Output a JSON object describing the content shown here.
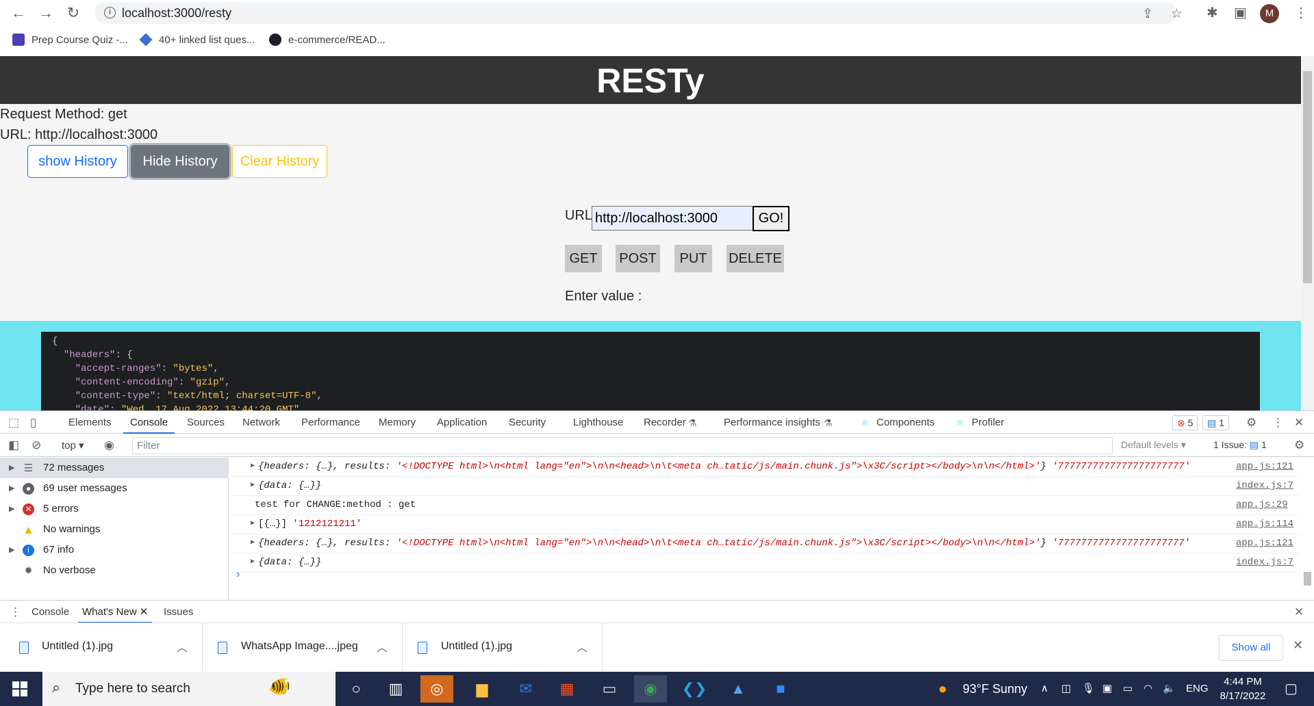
{
  "browser": {
    "url": "localhost:3000/resty",
    "avatar_letter": "M",
    "bookmarks": [
      {
        "label": "Prep Course Quiz -..."
      },
      {
        "label": "40+ linked list ques..."
      },
      {
        "label": "e-commerce/READ..."
      }
    ]
  },
  "app": {
    "title": "RESTy",
    "request_method_line": "Request Method: get",
    "url_line": "URL: http://localhost:3000",
    "history_buttons": {
      "show": "show History",
      "hide": "Hide History",
      "clear": "Clear History"
    },
    "form": {
      "url_label": "URL:",
      "url_value": "http://localhost:3000",
      "go": "GO!",
      "methods": [
        "GET",
        "POST",
        "PUT",
        "DELETE"
      ],
      "enter_value_label": "Enter value :"
    },
    "results": {
      "line0": "{",
      "l1_key": "\"headers\"",
      "l1_rest": ": {",
      "l2_key": "\"accept-ranges\"",
      "l2_val": "\"bytes\"",
      "l3_key": "\"content-encoding\"",
      "l3_val": "\"gzip\"",
      "l4_key": "\"content-type\"",
      "l4_val": "\"text/html; charset=UTF-8\"",
      "l5_key": "\"date\"",
      "l5_val": "\"Wed, 17 Aug 2022 13:44:20 GMT\""
    }
  },
  "devtools": {
    "tabs": [
      "Elements",
      "Console",
      "Sources",
      "Network",
      "Performance",
      "Memory",
      "Application",
      "Security",
      "Lighthouse",
      "Recorder",
      "Performance insights",
      "Components",
      "Profiler"
    ],
    "error_count": "5",
    "message_count": "1",
    "context": "top",
    "filter_placeholder": "Filter",
    "levels": "Default levels",
    "issues": "1 Issue:",
    "issues_count": "1",
    "sidebar": [
      {
        "label": "72 messages"
      },
      {
        "label": "69 user messages"
      },
      {
        "label": "5 errors"
      },
      {
        "label": "No warnings"
      },
      {
        "label": "67 info"
      },
      {
        "label": "No verbose"
      }
    ],
    "logs": [
      {
        "pre": "{headers: {…}, results: ",
        "str": "'<!DOCTYPE html>\\n<html lang=\"en\">\\n\\n<head>\\n\\t<meta ch…tatic/js/main.chunk.js\">\\x3C/script></body>\\n\\n</html>'",
        "post": "} ",
        "extra": "'7777777777777777777777'",
        "src": "app.js:121"
      },
      {
        "pre": "{data: {…}}",
        "str": "",
        "post": "",
        "extra": "",
        "src": "index.js:7"
      },
      {
        "pre": "test for CHANGE:method : get",
        "str": "",
        "post": "",
        "extra": "",
        "src": "app.js:29"
      },
      {
        "pre": "[{…}] ",
        "str": "",
        "post": "",
        "extra": "'1212121211'",
        "src": "app.js:114"
      },
      {
        "pre": "{headers: {…}, results: ",
        "str": "'<!DOCTYPE html>\\n<html lang=\"en\">\\n\\n<head>\\n\\t<meta ch…tatic/js/main.chunk.js\">\\x3C/script></body>\\n\\n</html>'",
        "post": "} ",
        "extra": "'7777777777777777777777'",
        "src": "app.js:121"
      },
      {
        "pre": "{data: {…}}",
        "str": "",
        "post": "",
        "extra": "",
        "src": "index.js:7"
      }
    ],
    "drawer_tabs": [
      "Console",
      "What's New",
      "Issues"
    ]
  },
  "downloads": {
    "items": [
      {
        "name": "Untitled (1).jpg"
      },
      {
        "name": "WhatsApp Image....jpeg"
      },
      {
        "name": "Untitled (1).jpg"
      }
    ],
    "show_all": "Show all"
  },
  "taskbar": {
    "search_placeholder": "Type here to search",
    "weather": "93°F  Sunny",
    "lang": "ENG",
    "time": "4:44 PM",
    "date": "8/17/2022"
  }
}
